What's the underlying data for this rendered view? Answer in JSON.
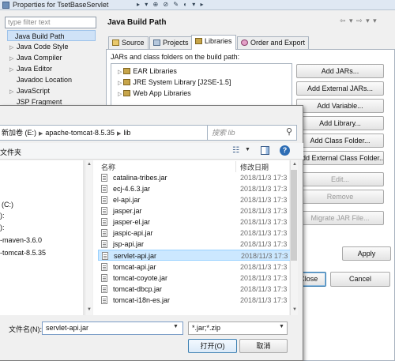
{
  "window": {
    "title": "Properties for TsetBaseServlet"
  },
  "sidebar": {
    "filter_placeholder": "type filter text",
    "items": [
      {
        "label": "Java Build Path",
        "expand": ""
      },
      {
        "label": "Java Code Style",
        "expand": "▷"
      },
      {
        "label": "Java Compiler",
        "expand": "▷"
      },
      {
        "label": "Java Editor",
        "expand": "▷"
      },
      {
        "label": "Javadoc Location",
        "expand": ""
      },
      {
        "label": "JavaScript",
        "expand": "▷"
      },
      {
        "label": "JSP Fragment",
        "expand": ""
      }
    ]
  },
  "page": {
    "title": "Java Build Path",
    "tabs": [
      {
        "label": "Source"
      },
      {
        "label": "Projects"
      },
      {
        "label": "Libraries"
      },
      {
        "label": "Order and Export"
      }
    ],
    "jars_label": "JARs and class folders on the build path:",
    "libraries": [
      {
        "label": "EAR Libraries"
      },
      {
        "label": "JRE System Library [J2SE-1.5]"
      },
      {
        "label": "Web App Libraries"
      }
    ],
    "buttons": {
      "add_jars": "Add JARs...",
      "add_external_jars": "Add External JARs...",
      "add_variable": "Add Variable...",
      "add_library": "Add Library...",
      "add_class_folder": "Add Class Folder...",
      "add_external_class_folder": "Add External Class Folder...",
      "edit": "Edit...",
      "remove": "Remove",
      "migrate_jar": "Migrate JAR File..."
    },
    "apply": "Apply",
    "close": "d Close",
    "cancel": "Cancel"
  },
  "file_dialog": {
    "breadcrumb": [
      "新加卷 (E:)",
      "apache-tomcat-8.5.35",
      "lib"
    ],
    "search_placeholder": "搜索 lib",
    "new_folder": "文件夹",
    "nav_items": [
      {
        "label": "(C:)"
      },
      {
        "label": "):"
      },
      {
        "label": "):"
      },
      {
        "label": "-maven-3.6.0"
      },
      {
        "label": "-tomcat-8.5.35"
      }
    ],
    "columns": {
      "name": "名称",
      "date": "修改日期"
    },
    "files": [
      {
        "name": "catalina-tribes.jar",
        "date": "2018/11/3 17:3"
      },
      {
        "name": "ecj-4.6.3.jar",
        "date": "2018/11/3 17:3"
      },
      {
        "name": "el-api.jar",
        "date": "2018/11/3 17:3"
      },
      {
        "name": "jasper.jar",
        "date": "2018/11/3 17:3"
      },
      {
        "name": "jasper-el.jar",
        "date": "2018/11/3 17:3"
      },
      {
        "name": "jaspic-api.jar",
        "date": "2018/11/3 17:3"
      },
      {
        "name": "jsp-api.jar",
        "date": "2018/11/3 17:3"
      },
      {
        "name": "servlet-api.jar",
        "date": "2018/11/3 17:3"
      },
      {
        "name": "tomcat-api.jar",
        "date": "2018/11/3 17:3"
      },
      {
        "name": "tomcat-coyote.jar",
        "date": "2018/11/3 17:3"
      },
      {
        "name": "tomcat-dbcp.jar",
        "date": "2018/11/3 17:3"
      },
      {
        "name": "tomcat-i18n-es.jar",
        "date": "2018/11/3 17:3"
      }
    ],
    "selected_file": "servlet-api.jar",
    "filename_label": "文件名(N):",
    "filename_value": "servlet-api.jar",
    "filter_value": "*.jar;*.zip",
    "open": "打开(O)",
    "cancel": "取消"
  },
  "colors": {
    "selection": "#cce8ff",
    "tree_selection": "#cfe2f7",
    "accent": "#3c7fb1"
  },
  "icons": [
    "search-icon",
    "refresh-icon",
    "view-icon",
    "preview-pane-icon",
    "help-icon",
    "jar-file-icon",
    "library-icon"
  ]
}
